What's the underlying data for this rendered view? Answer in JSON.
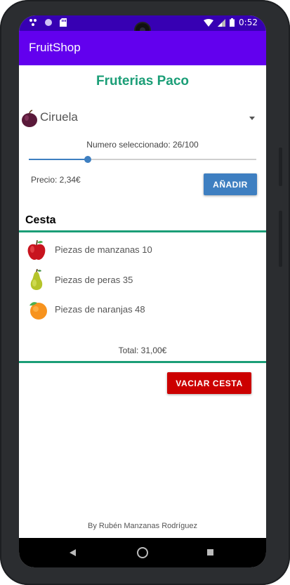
{
  "status_bar": {
    "time": "0:52"
  },
  "app_bar": {
    "title": "FruitShop"
  },
  "shop": {
    "title": "Fruterias Paco"
  },
  "selector": {
    "selected": "Ciruela",
    "icon": "plum-icon"
  },
  "seekbar": {
    "text": "Numero seleccionado: 26/100",
    "value": 26,
    "max": 100
  },
  "price": {
    "text": "Precio: 2,34€"
  },
  "buttons": {
    "add": "AÑADIR",
    "empty": "VACIAR CESTA"
  },
  "basket": {
    "title": "Cesta",
    "items": [
      {
        "icon": "apple-icon",
        "text": "Piezas de manzanas 10"
      },
      {
        "icon": "pear-icon",
        "text": "Piezas de peras 35"
      },
      {
        "icon": "orange-icon",
        "text": "Piezas de naranjas 48"
      }
    ],
    "total": "Total: 31,00€"
  },
  "footer": {
    "credit": "By Rubén Manzanas Rodríguez"
  },
  "colors": {
    "app_bar": "#6200ee",
    "status_bar": "#3700b3",
    "accent_green": "#1b9e77",
    "blue_button": "#3e7fc1",
    "red_button": "#cc0000"
  }
}
